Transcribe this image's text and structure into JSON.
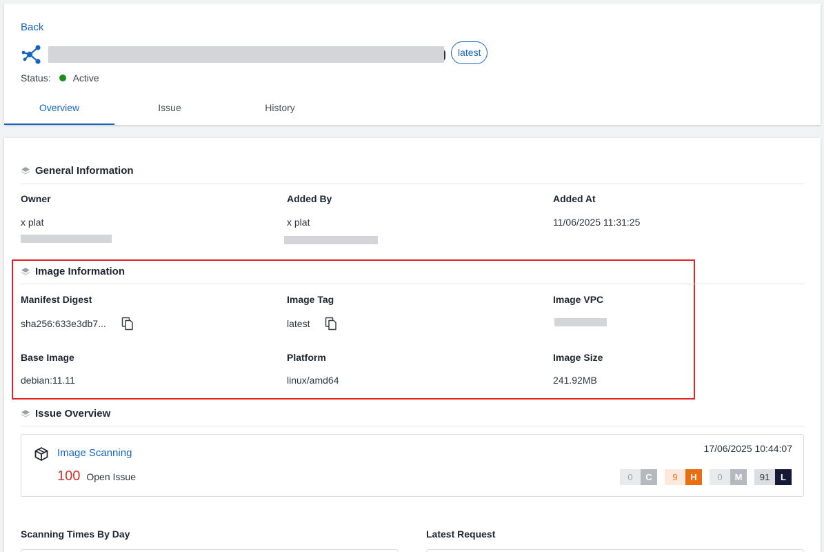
{
  "header": {
    "back_label": "Back",
    "tag_label": "latest",
    "status_label": "Status:",
    "status_value": "Active",
    "status_color": "#1a8f1a",
    "tabs": [
      {
        "label": "Overview",
        "active": true
      },
      {
        "label": "Issue",
        "active": false
      },
      {
        "label": "History",
        "active": false
      }
    ]
  },
  "general": {
    "title": "General Information",
    "owner_label": "Owner",
    "owner_value": "x plat",
    "added_by_label": "Added By",
    "added_by_value": "x plat",
    "added_at_label": "Added At",
    "added_at_value": "11/06/2025 11:31:25"
  },
  "image_info": {
    "title": "Image Information",
    "manifest_label": "Manifest Digest",
    "manifest_value": "sha256:633e3db7...",
    "tag_label": "Image Tag",
    "tag_value": "latest",
    "vpc_label": "Image VPC",
    "base_label": "Base Image",
    "base_value": "debian:11.11",
    "platform_label": "Platform",
    "platform_value": "linux/amd64",
    "size_label": "Image Size",
    "size_value": "241.92MB"
  },
  "issue_overview": {
    "title": "Issue Overview",
    "scan_label": "Image Scanning",
    "scan_time": "17/06/2025 10:44:07",
    "count": "100",
    "count_label": "Open Issue",
    "severity": [
      {
        "count": "0",
        "letter": "C",
        "count_bg": "#e9eaec",
        "count_color": "#9ea2aa",
        "letter_bg": "#b5b8bd"
      },
      {
        "count": "9",
        "letter": "H",
        "count_bg": "#fde8dd",
        "count_color": "#e86a1a",
        "letter_bg": "#ea6d11"
      },
      {
        "count": "0",
        "letter": "M",
        "count_bg": "#e9eaec",
        "count_color": "#9ea2aa",
        "letter_bg": "#b5b8bd"
      },
      {
        "count": "91",
        "letter": "L",
        "count_bg": "#dcdde0",
        "count_color": "#2d323d",
        "letter_bg": "#141a33"
      }
    ]
  },
  "bottom": {
    "scan_times_label": "Scanning Times By Day",
    "latest_request_label": "Latest Request"
  },
  "accent_color": "#1565c0",
  "highlight_color": "#e02424"
}
